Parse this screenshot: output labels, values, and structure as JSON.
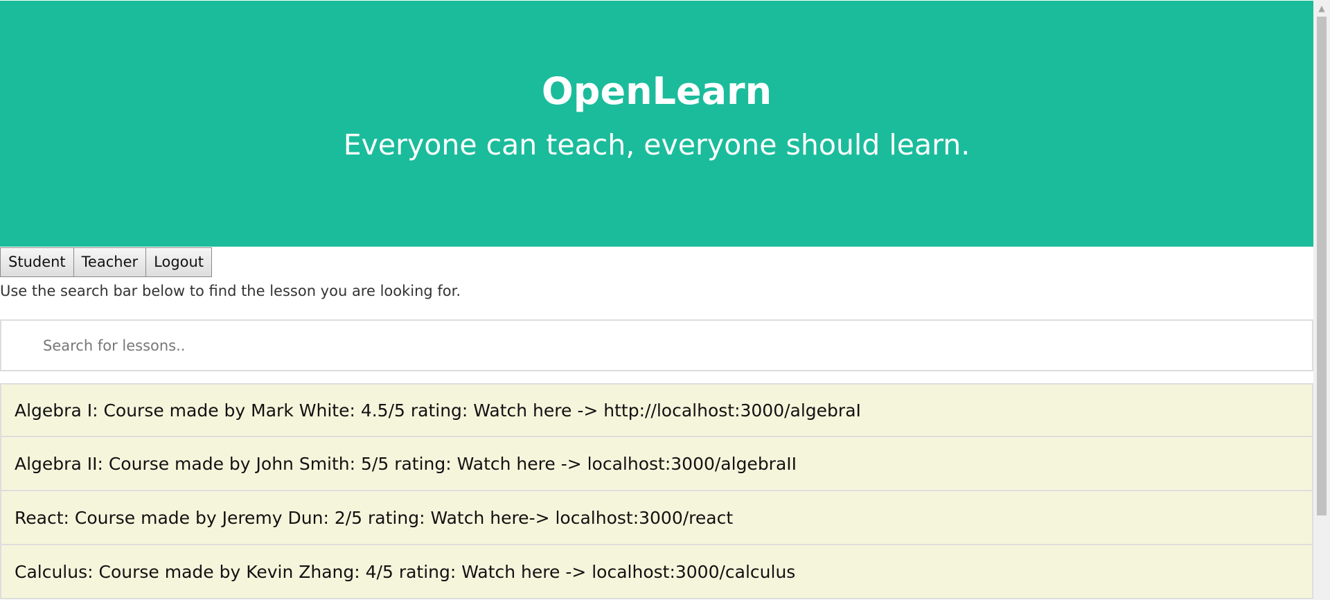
{
  "header": {
    "title": "OpenLearn",
    "subtitle": "Everyone can teach, everyone should learn."
  },
  "nav": {
    "student_label": "Student",
    "teacher_label": "Teacher",
    "logout_label": "Logout"
  },
  "instructions": "Use the search bar below to find the lesson you are looking for.",
  "search": {
    "placeholder": "Search for lessons..",
    "value": ""
  },
  "lessons": [
    "Algebra I: Course made by Mark White: 4.5/5 rating: Watch here -> http://localhost:3000/algebraI",
    "Algebra II: Course made by John Smith: 5/5 rating: Watch here -> localhost:3000/algebraII",
    "React: Course made by Jeremy Dun: 2/5 rating: Watch here-> localhost:3000/react",
    "Calculus: Course made by Kevin Zhang: 4/5 rating: Watch here -> localhost:3000/calculus"
  ],
  "colors": {
    "header_background": "#1bbc9b",
    "lesson_background": "#f5f5dc"
  },
  "scrollbar": {
    "up_icon": "chevron-up-icon"
  }
}
